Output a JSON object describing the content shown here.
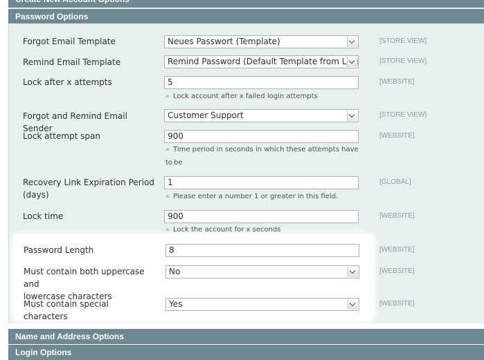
{
  "sections": {
    "top": "Create New Account Options",
    "password": "Password Options",
    "name_address": "Name and Address Options",
    "login": "Login Options"
  },
  "rows": {
    "forgot_template": {
      "label": "Forgot Email Template",
      "value": "Neues Passwort (Template)",
      "scope": "[STORE VIEW]"
    },
    "remind_template": {
      "label": "Remind Email Template",
      "value": "Remind Password (Default Template from Locale)",
      "scope": "[STORE VIEW]"
    },
    "lock_attempts": {
      "label": "Lock after x attempts",
      "value": "5",
      "note": "Lock account after x failed login attempts",
      "scope": "[WEBSITE]"
    },
    "sender": {
      "label": "Forgot and Remind Email Sender",
      "value": "Customer Support",
      "scope": "[STORE VIEW]"
    },
    "lock_span": {
      "label": "Lock attempt span",
      "value": "900",
      "note_line1": "Time period in seconds in which these attempts have to",
      "note_line2": "be",
      "scope": "[WEBSITE]"
    },
    "recovery": {
      "label_line1": "Recovery Link Expiration Period",
      "label_line2": "(days)",
      "value": "1",
      "note": "Please enter a number 1 or greater in this field.",
      "scope": "[GLOBAL]"
    },
    "lock_time": {
      "label": "Lock time",
      "value": "900",
      "note": "Lock the account for x seconds",
      "scope": "[WEBSITE]"
    },
    "pw_length": {
      "label": "Password Length",
      "value": "8",
      "scope": "[WEBSITE]"
    },
    "upper_lower": {
      "label_line1": "Must contain both uppercase and",
      "label_line2": "lowercase characters",
      "value": "No",
      "scope": "[WEBSITE]"
    },
    "special": {
      "label": "Must contain special characters",
      "value": "Yes",
      "scope": "[WEBSITE]"
    }
  },
  "colors": {
    "header_bg": "#6f8992",
    "panel_bg": "#e7efef",
    "scope_text": "#8c9ea8"
  }
}
